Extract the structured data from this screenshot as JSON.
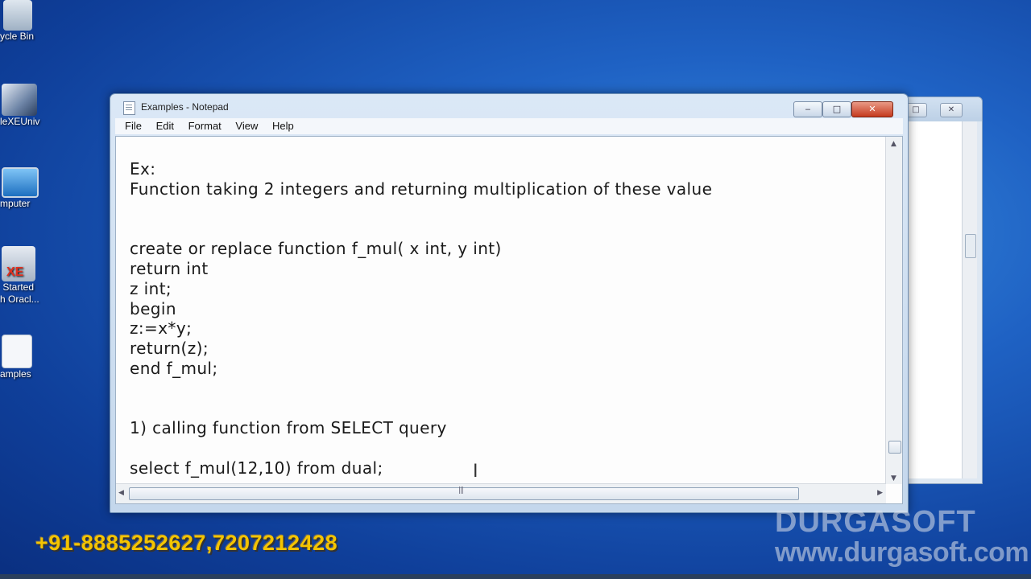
{
  "desktop": {
    "icons": [
      {
        "label": "ycle Bin",
        "icon": "recycle-bin-icon"
      },
      {
        "label": "leXEUniv",
        "icon": "oracle-installer-icon"
      },
      {
        "label": "mputer",
        "icon": "computer-icon"
      },
      {
        "label": " Started\nh Oracl...",
        "icon": "oracle-xe-icon"
      },
      {
        "label": "amples",
        "icon": "text-file-icon"
      }
    ]
  },
  "window": {
    "title": "Examples - Notepad",
    "buttons": {
      "minimize": "‒",
      "maximize": "□",
      "close": "✕"
    }
  },
  "menu": {
    "file": "File",
    "edit": "Edit",
    "format": "Format",
    "view": "View",
    "help": "Help"
  },
  "editor": {
    "content": "Ex:\nFunction taking 2 integers and returning multiplication of these value\n\n\ncreate or replace function f_mul( x int, y int)\nreturn int\nz int;\nbegin\nz:=x*y;\nreturn(z);\nend f_mul;\n\n\n1) calling function from SELECT query\n\nselect f_mul(12,10) from dual;"
  },
  "overlay": {
    "phone": "+91-8885252627,7207212428",
    "brand": "DURGASOFT",
    "url": "www.durgasoft.com"
  },
  "colors": {
    "desktop": "#1f62c4",
    "phone_text": "#f4c400",
    "close_button": "#c53a1e"
  }
}
